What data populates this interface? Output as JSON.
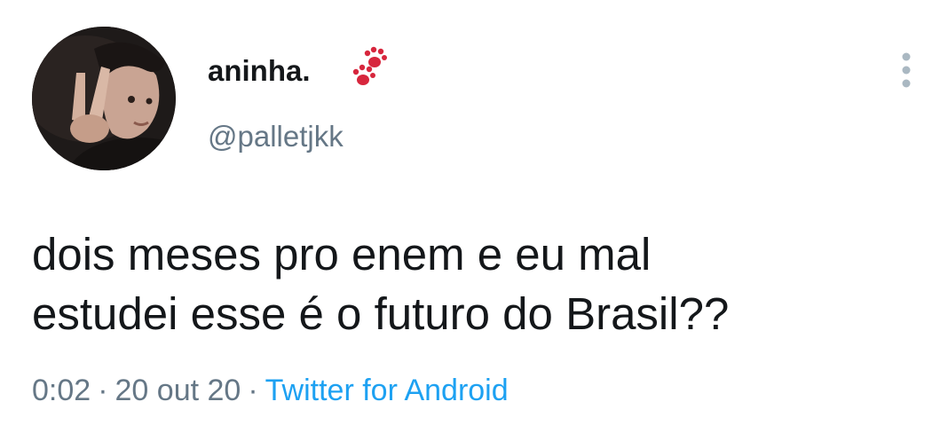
{
  "user": {
    "display_name": "aninha.",
    "handle": "@palletjkk",
    "avatar": "profile-photo",
    "badge_icon": "paw-prints-icon"
  },
  "menu": {
    "icon": "vertical-ellipsis-icon"
  },
  "tweet": {
    "line1": "dois meses pro enem e eu mal",
    "line2": "estudei esse é o futuro do Brasil??"
  },
  "meta": {
    "time": "0:02",
    "separator": "·",
    "date": "20 out 20",
    "source": "Twitter for Android"
  },
  "colors": {
    "text": "#14171a",
    "secondary": "#657786",
    "link": "#1da1f2",
    "paw": "#e0245e"
  }
}
